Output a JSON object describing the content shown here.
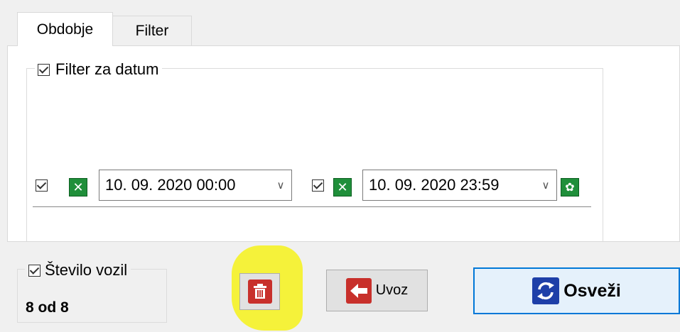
{
  "tabs": [
    {
      "label": "Obdobje",
      "active": true
    },
    {
      "label": "Filter",
      "active": false
    }
  ],
  "date_filter": {
    "label": "Filter za datum",
    "checked": true,
    "from": {
      "checked": true,
      "value": "10. 09. 2020 00:00"
    },
    "to": {
      "checked": true,
      "value": "10. 09. 2020 23:59"
    }
  },
  "vehicles": {
    "label": "Število vozil",
    "checked": true,
    "count_text": "8 od 8"
  },
  "buttons": {
    "import_label": "Uvoz",
    "refresh_label": "Osveži"
  },
  "icons": {
    "clear_from": "x-icon",
    "clear_to": "x-icon",
    "settings": "gear-icon",
    "delete": "trash-icon",
    "import": "arrow-left-icon",
    "refresh": "refresh-icon"
  },
  "colors": {
    "green_button": "#1f8f3a",
    "red_button": "#c8302b",
    "blue_icon": "#1e3fa8",
    "highlight": "#f5f23a",
    "refresh_border": "#0078d7"
  }
}
